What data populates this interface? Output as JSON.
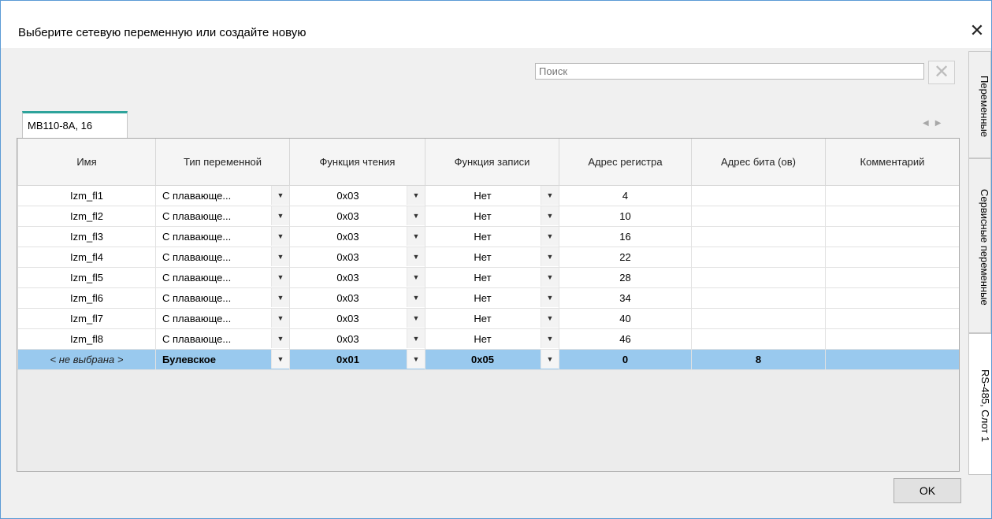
{
  "dialog": {
    "title": "Выберите сетевую переменную или создайте новую"
  },
  "search": {
    "placeholder": "Поиск"
  },
  "tab": {
    "label": "МВ110-8А, 16"
  },
  "columns": [
    "Имя",
    "Тип переменной",
    "Функция чтения",
    "Функция записи",
    "Адрес регистра",
    "Адрес бита (ов)",
    "Комментарий"
  ],
  "rows": [
    {
      "name": "Izm_fl1",
      "type": "С плавающе...",
      "read": "0x03",
      "write": "Нет",
      "addr": "4",
      "bit": "",
      "comment": ""
    },
    {
      "name": "Izm_fl2",
      "type": "С плавающе...",
      "read": "0x03",
      "write": "Нет",
      "addr": "10",
      "bit": "",
      "comment": ""
    },
    {
      "name": "Izm_fl3",
      "type": "С плавающе...",
      "read": "0x03",
      "write": "Нет",
      "addr": "16",
      "bit": "",
      "comment": ""
    },
    {
      "name": "Izm_fl4",
      "type": "С плавающе...",
      "read": "0x03",
      "write": "Нет",
      "addr": "22",
      "bit": "",
      "comment": ""
    },
    {
      "name": "Izm_fl5",
      "type": "С плавающе...",
      "read": "0x03",
      "write": "Нет",
      "addr": "28",
      "bit": "",
      "comment": ""
    },
    {
      "name": "Izm_fl6",
      "type": "С плавающе...",
      "read": "0x03",
      "write": "Нет",
      "addr": "34",
      "bit": "",
      "comment": ""
    },
    {
      "name": "Izm_fl7",
      "type": "С плавающе...",
      "read": "0x03",
      "write": "Нет",
      "addr": "40",
      "bit": "",
      "comment": ""
    },
    {
      "name": "Izm_fl8",
      "type": "С плавающе...",
      "read": "0x03",
      "write": "Нет",
      "addr": "46",
      "bit": "",
      "comment": ""
    },
    {
      "name": "< не выбрана >",
      "type": "Булевское",
      "read": "0x01",
      "write": "0x05",
      "addr": "0",
      "bit": "8",
      "comment": ""
    }
  ],
  "side_tabs": [
    "Переменные",
    "Сервисные переменные",
    "RS-485, Слот 1"
  ],
  "buttons": {
    "ok": "OK"
  },
  "icons": {
    "close": "close-icon",
    "clear": "clear-search-icon",
    "dropdown": "chevron-down-icon"
  }
}
